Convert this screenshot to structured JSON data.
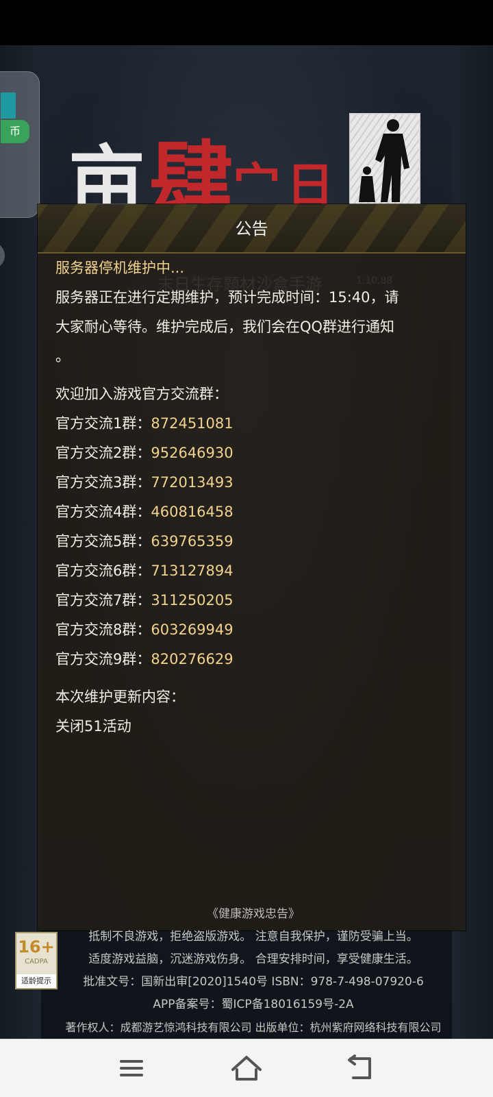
{
  "panel": {
    "title": "公告",
    "watermark_slogan": "末日生存题材沙盒手游",
    "watermark_version": "1.10.88"
  },
  "announcement": {
    "heading": "服务器停机维护中...",
    "maintenance_line1": "服务器正在进行定期维护，预计完成时间：15:40，请",
    "maintenance_line2": "大家耐心等待。维护完成后，我们会在QQ群进行通知",
    "maintenance_line3": "。",
    "groups_intro": "欢迎加入游戏官方交流群：",
    "groups": [
      {
        "label": "官方交流1群：",
        "number": "872451081"
      },
      {
        "label": "官方交流2群：",
        "number": "952646930"
      },
      {
        "label": "官方交流3群：",
        "number": "772013493"
      },
      {
        "label": "官方交流4群：",
        "number": "460816458"
      },
      {
        "label": "官方交流5群：",
        "number": "639765359"
      },
      {
        "label": "官方交流6群：",
        "number": "713127894"
      },
      {
        "label": "官方交流7群：",
        "number": "311250205"
      },
      {
        "label": "官方交流8群：",
        "number": "603269949"
      },
      {
        "label": "官方交流9群：",
        "number": "820276629"
      }
    ],
    "update_heading": "本次维护更新内容：",
    "update_item": "关闭51活动"
  },
  "notice": {
    "title": "《健康游戏忠告》",
    "line1": "抵制不良游戏，拒绝盗版游戏。 注意自我保护，谨防受骗上当。",
    "line2": "适度游戏益脑，沉迷游戏伤身。 合理安排时间，享受健康生活。",
    "line3": "批准文号：国新出审[2020]1540号    ISBN：978-7-498-07920-6",
    "line4": "APP备案号：蜀ICP备18016159号-2A",
    "line5": "著作权人：成都游艺惊鸿科技有限公司 出版单位：杭州紫府网络科技有限公司"
  },
  "age_rating": {
    "age": "16+",
    "org": "CADPA",
    "tip": "适龄提示"
  },
  "side_widget": {
    "badge": "币"
  },
  "colors": {
    "accent_gold": "#f2d28f",
    "logo_red": "#c0282b"
  },
  "icons": {
    "menu": "menu-icon",
    "home": "home-icon",
    "back": "back-icon"
  }
}
